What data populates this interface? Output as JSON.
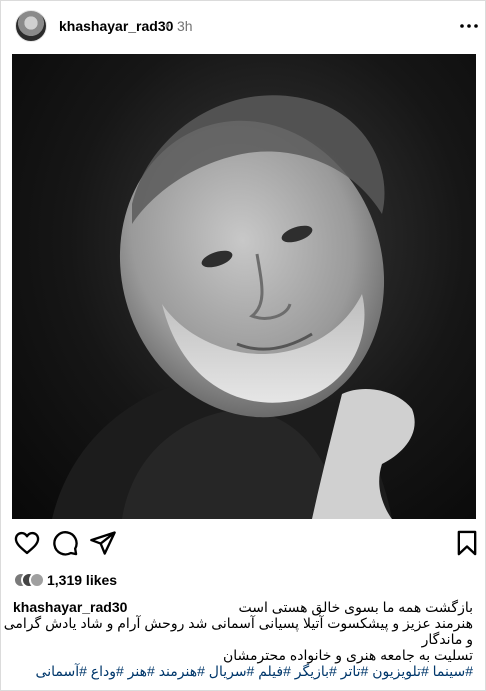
{
  "post": {
    "username": "khashayar_rad30",
    "separator": "•",
    "time": "3h"
  },
  "icons": {
    "more": "more-horizontal-icon",
    "like": "heart-icon",
    "comment": "comment-icon",
    "share": "send-icon",
    "save": "bookmark-icon"
  },
  "likes": {
    "count_text": "1,319 likes"
  },
  "caption": {
    "username": "khashayar_rad30",
    "line1": "بازگشت همه ما بسوی خالق هستی است",
    "line2": "هنرمند عزیز و پیشکسوت آتیلا پسیانی آسمانی شد روحش آرام و شاد یادش گرامی",
    "line3": "و ماندگار",
    "line4": "تسلیت به جامعه هنری و خانواده محترمشان",
    "hashtags": "#سینما #تلویزیون #تاتر #بازیگر #فیلم #سریال #هنرمند #هنر #وداع #آسمانی"
  }
}
